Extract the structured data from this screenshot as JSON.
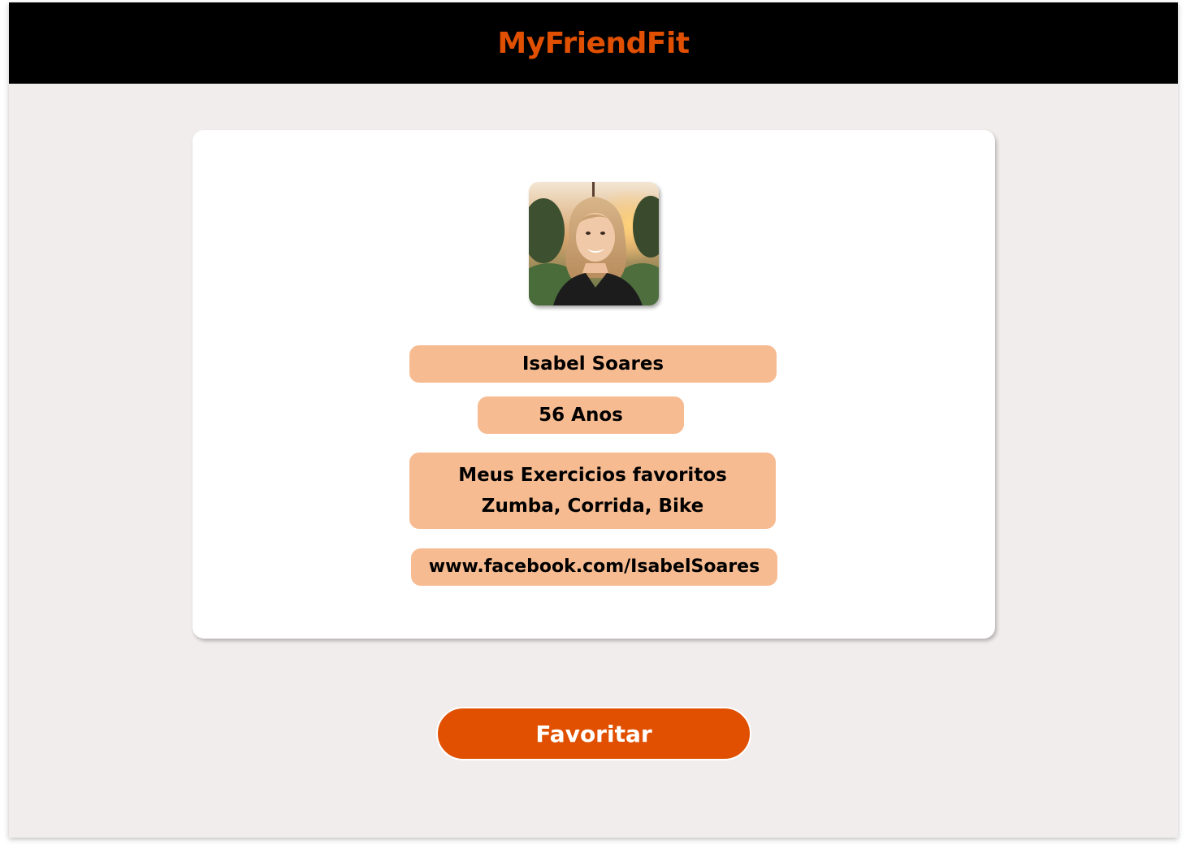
{
  "header": {
    "brand": "MyFriendFit",
    "brand_color": "#e05000",
    "background": "#000000"
  },
  "profile": {
    "avatar_icon": "profile-photo",
    "name": "Isabel Soares",
    "age": "56 Anos",
    "favorites_title": "Meus Exercicios favoritos",
    "favorites_list": "Zumba, Corrida, Bike",
    "link": "www.facebook.com/IsabelSoares",
    "pill_color": "#f7bb91"
  },
  "actions": {
    "favorite_label": "Favoritar",
    "favorite_color": "#e05000"
  }
}
